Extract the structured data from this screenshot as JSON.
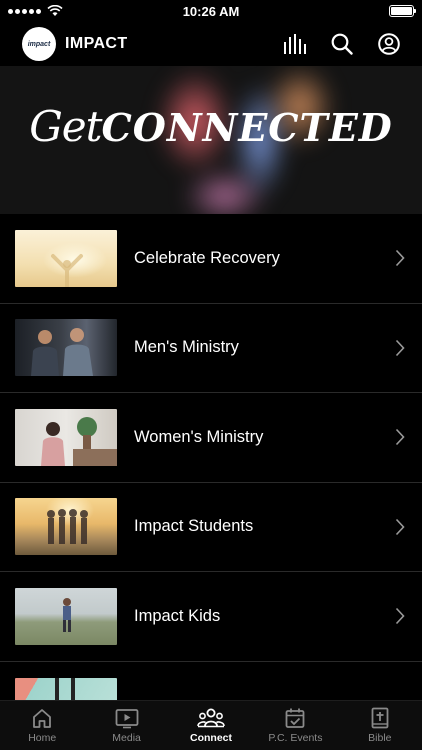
{
  "status_bar": {
    "time": "10:26 AM"
  },
  "header": {
    "logo_text": "impact",
    "title": "IMPACT",
    "icons": [
      "equalizer-icon",
      "search-icon",
      "account-icon"
    ]
  },
  "hero": {
    "script_word": "Get",
    "main_word": "CONNECTED"
  },
  "list": {
    "items": [
      {
        "label": "Celebrate Recovery",
        "thumb": "celebrate-recovery-thumbnail"
      },
      {
        "label": "Men's Ministry",
        "thumb": "mens-ministry-thumbnail"
      },
      {
        "label": "Women's Ministry",
        "thumb": "womens-ministry-thumbnail"
      },
      {
        "label": "Impact Students",
        "thumb": "impact-students-thumbnail"
      },
      {
        "label": "Impact Kids",
        "thumb": "impact-kids-thumbnail"
      }
    ]
  },
  "tabbar": {
    "tabs": [
      {
        "label": "Home",
        "icon": "home-icon",
        "active": false
      },
      {
        "label": "Media",
        "icon": "play-icon",
        "active": false
      },
      {
        "label": "Connect",
        "icon": "group-icon",
        "active": true
      },
      {
        "label": "P.C. Events",
        "icon": "calendar-check-icon",
        "active": false
      },
      {
        "label": "Bible",
        "icon": "bible-icon",
        "active": false
      }
    ]
  },
  "colors": {
    "background": "#000000",
    "active_tab": "#ffffff",
    "inactive_tab": "#8a8a8a"
  }
}
